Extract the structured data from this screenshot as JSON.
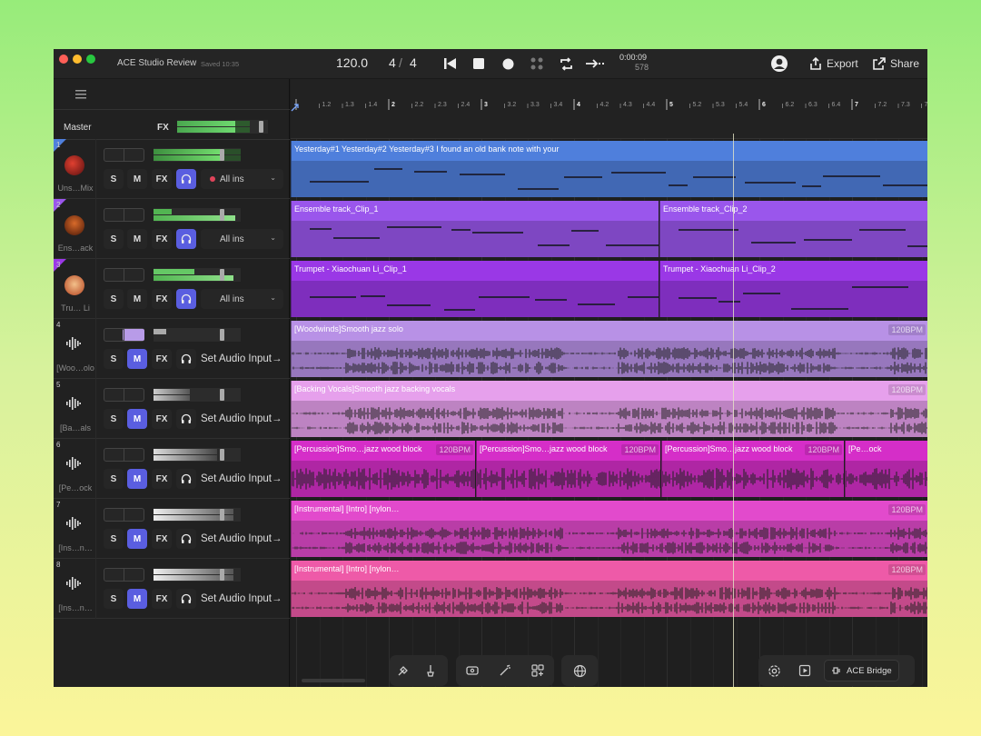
{
  "window": {
    "app_title": "ACE Studio Review",
    "saved_status": "Saved 10:35",
    "tempo": "120.0",
    "time_sig_num": "4",
    "time_sig_sep": "/",
    "time_sig_den": "4",
    "time": "0:00:09",
    "bar_beat": "578",
    "export_label": "Export",
    "share_label": "Share"
  },
  "sidebar": {
    "master_label": "Master",
    "fx_label": "FX"
  },
  "ruler_ticks": [
    "1.2",
    "1.3",
    "1.4",
    "2",
    "2.2",
    "2.3",
    "2.4",
    "3",
    "3.2",
    "3.3",
    "3.4",
    "4",
    "4.2",
    "4.3",
    "4.4",
    "5",
    "5.2",
    "5.3",
    "5.4",
    "6",
    "6.2",
    "6.3",
    "6.4",
    "7",
    "7.2",
    "7.3",
    "7.4"
  ],
  "buttons": {
    "solo": "S",
    "mute": "M",
    "fx": "FX"
  },
  "tracks": [
    {
      "num": "1",
      "name": "Uns…Mix",
      "input": "All ins",
      "has_dot": true,
      "muted": false,
      "headphone": true
    },
    {
      "num": "2",
      "name": "Ens…ack",
      "input": "All ins",
      "has_dot": false,
      "muted": false,
      "headphone": true
    },
    {
      "num": "3",
      "name": "Tru… Li",
      "input": "All ins",
      "has_dot": false,
      "muted": false,
      "headphone": true
    },
    {
      "num": "4",
      "name": "[Woo…olo",
      "input": "Set Audio Input→",
      "muted": true,
      "headphone": false
    },
    {
      "num": "5",
      "name": "[Ba…als",
      "input": "Set Audio Input→",
      "muted": true,
      "headphone": false
    },
    {
      "num": "6",
      "name": "[Pe…ock",
      "input": "Set Audio Input→",
      "muted": true,
      "headphone": false
    },
    {
      "num": "7",
      "name": "[Ins…n…",
      "input": "Set Audio Input→",
      "muted": true,
      "headphone": false
    },
    {
      "num": "8",
      "name": "[Ins…n…",
      "input": "Set Audio Input→",
      "muted": true,
      "headphone": false
    }
  ],
  "clips": {
    "t1": {
      "label": "Yesterday#1 Yesterday#2 Yesterday#3 I found an old bank note with your"
    },
    "t2a": {
      "label": "Ensemble track_Clip_1"
    },
    "t2b": {
      "label": "Ensemble track_Clip_2"
    },
    "t3a": {
      "label": "Trumpet - Xiaochuan Li_Clip_1"
    },
    "t3b": {
      "label": "Trumpet - Xiaochuan Li_Clip_2"
    },
    "t4": {
      "label": "[Woodwinds]Smooth jazz solo",
      "bpm": "120BPM"
    },
    "t5": {
      "label": "[Backing Vocals]Smooth jazz backing vocals",
      "bpm": "120BPM"
    },
    "t6a": {
      "label": "[Percussion]Smo…jazz wood block",
      "bpm": "120BPM"
    },
    "t6b": {
      "label": "[Percussion]Smo…jazz wood block",
      "bpm": "120BPM"
    },
    "t6c": {
      "label": "[Percussion]Smo…jazz wood block",
      "bpm": "120BPM"
    },
    "t6d": {
      "label": "[Pe…ock"
    },
    "t7": {
      "label": "[Instrumental]  [Intro] [nylon…",
      "bpm": "120BPM"
    },
    "t8": {
      "label": "[Instrumental]  [Intro] [nylon…",
      "bpm": "120BPM"
    }
  },
  "bottom_toolbar": {
    "ace_bridge_label": "ACE Bridge"
  },
  "colors": {
    "t1": "#4f7fdc",
    "t2": "#9a56ec",
    "t3": "#9a38e6",
    "t4": "#b891e6",
    "t5": "#e6a0ec",
    "t6": "#d52ec8",
    "t7": "#e24acc",
    "t8": "#ee5aa8",
    "accent": "#5a5ee0"
  }
}
